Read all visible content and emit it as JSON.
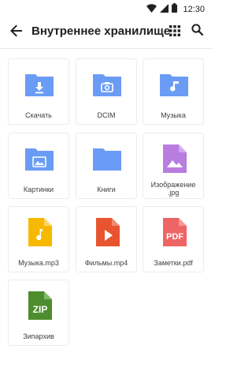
{
  "status_bar": {
    "time": "12:30"
  },
  "app_bar": {
    "back_icon": "arrow-back-icon",
    "title": "Внутреннее хранилище",
    "grid_icon": "grid-view-icon",
    "search_icon": "search-icon"
  },
  "colors": {
    "folder": "#6b9cf5",
    "image_file": "#b97de0",
    "audio_file": "#f6b800",
    "video_file": "#e8542f",
    "pdf_file": "#ef6464",
    "zip_file": "#4d8d2e"
  },
  "items": [
    {
      "label": "Скачать",
      "icon": "download-folder-icon"
    },
    {
      "label": "DCIM",
      "icon": "camera-folder-icon"
    },
    {
      "label": "Музыка",
      "icon": "music-folder-icon"
    },
    {
      "label": "Картинки",
      "icon": "pictures-folder-icon"
    },
    {
      "label": "Книги",
      "icon": "folder-icon"
    },
    {
      "label": "Изображение",
      "label_line2": ".jpg",
      "icon": "image-file-icon"
    },
    {
      "label": "Музыка.mp3",
      "icon": "audio-file-icon"
    },
    {
      "label": "Фильмы.mp4",
      "icon": "video-file-icon"
    },
    {
      "label": "Заметки.pdf",
      "icon": "pdf-file-icon",
      "badge": "PDF"
    },
    {
      "label": "Зипархив",
      "icon": "zip-file-icon",
      "badge": "ZIP"
    }
  ]
}
